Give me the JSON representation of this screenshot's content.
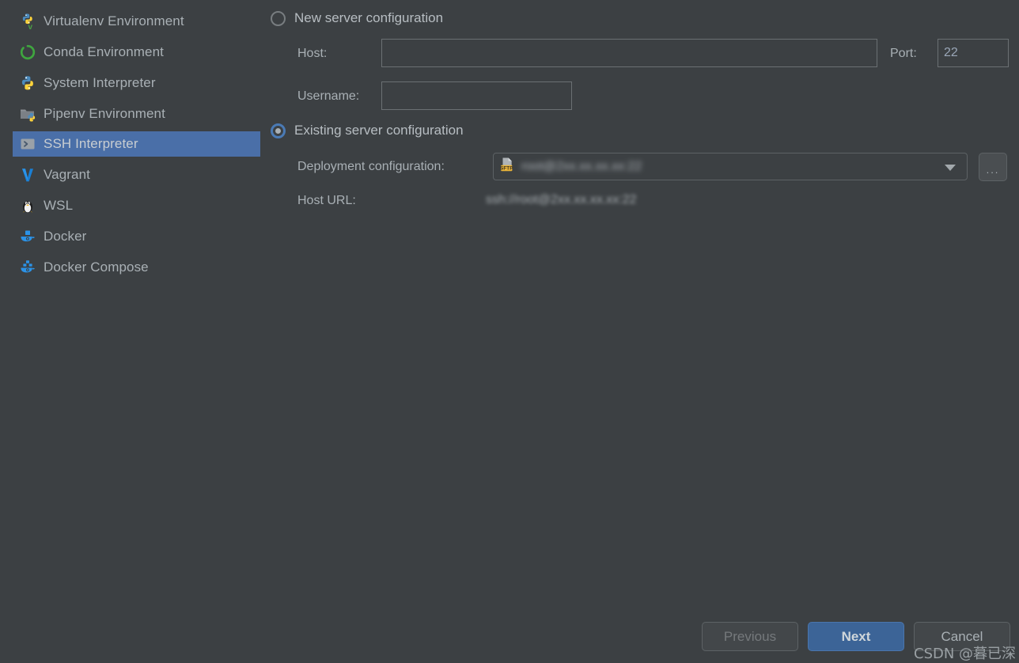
{
  "sidebar": {
    "items": [
      {
        "label": "Virtualenv Environment",
        "icon": "python-virtualenv-icon",
        "selected": false
      },
      {
        "label": "Conda Environment",
        "icon": "conda-icon",
        "selected": false
      },
      {
        "label": "System Interpreter",
        "icon": "python-icon",
        "selected": false
      },
      {
        "label": "Pipenv Environment",
        "icon": "pipenv-folder-icon",
        "selected": false
      },
      {
        "label": "SSH Interpreter",
        "icon": "ssh-console-icon",
        "selected": true
      },
      {
        "label": "Vagrant",
        "icon": "vagrant-icon",
        "selected": false
      },
      {
        "label": "WSL",
        "icon": "linux-penguin-icon",
        "selected": false
      },
      {
        "label": "Docker",
        "icon": "docker-whale-icon",
        "selected": false
      },
      {
        "label": "Docker Compose",
        "icon": "docker-compose-icon",
        "selected": false
      }
    ]
  },
  "main": {
    "new_server": {
      "radio_label": "New server configuration",
      "selected": false,
      "host_label": "Host:",
      "host_value": "",
      "host_placeholder": "",
      "port_label": "Port:",
      "port_value": "22",
      "username_label": "Username:",
      "username_value": "",
      "username_placeholder": ""
    },
    "existing_server": {
      "radio_label": "Existing server configuration",
      "selected": true,
      "deployment_label": "Deployment configuration:",
      "deployment_value": "root@2xx.xx.xx.xx:22",
      "deployment_icon": "sftp-file-icon",
      "browse_label": "...",
      "host_url_label": "Host URL:",
      "host_url_value": "ssh://root@2xx.xx.xx.xx:22"
    }
  },
  "footer": {
    "previous_label": "Previous",
    "previous_enabled": false,
    "next_label": "Next",
    "next_enabled": true,
    "cancel_label": "Cancel"
  },
  "watermark": {
    "text": "CSDN @暮已深"
  },
  "colors": {
    "background": "#3c4043",
    "selection": "#4a6fa8",
    "primary_button": "#3c6497",
    "text": "#a9b0b5",
    "field_border": "#6b7073",
    "sftp_badge": "#e8b339"
  }
}
